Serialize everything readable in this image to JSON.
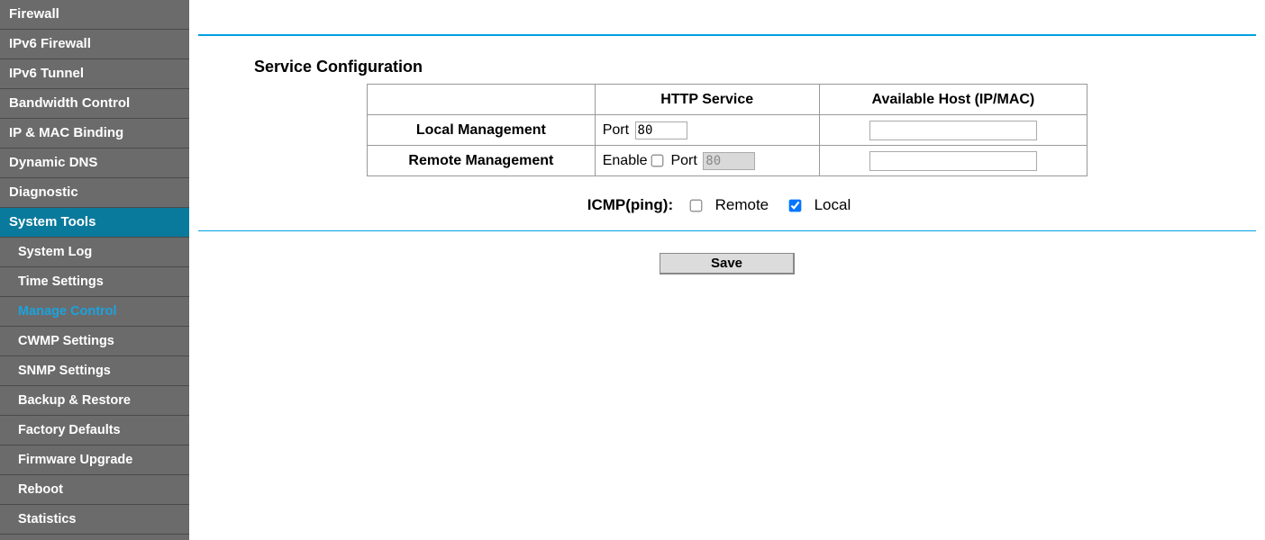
{
  "sidebar": {
    "items": [
      {
        "label": "Firewall",
        "kind": "nav",
        "sel": false
      },
      {
        "label": "IPv6 Firewall",
        "kind": "nav",
        "sel": false
      },
      {
        "label": "IPv6 Tunnel",
        "kind": "nav",
        "sel": false
      },
      {
        "label": "Bandwidth Control",
        "kind": "nav",
        "sel": false
      },
      {
        "label": "IP & MAC Binding",
        "kind": "nav",
        "sel": false
      },
      {
        "label": "Dynamic DNS",
        "kind": "nav",
        "sel": false
      },
      {
        "label": "Diagnostic",
        "kind": "nav",
        "sel": false
      },
      {
        "label": "System Tools",
        "kind": "nav",
        "sel": true
      },
      {
        "label": "System Log",
        "kind": "sub",
        "sel": false
      },
      {
        "label": "Time Settings",
        "kind": "sub",
        "sel": false
      },
      {
        "label": "Manage Control",
        "kind": "sub",
        "sel": true
      },
      {
        "label": "CWMP Settings",
        "kind": "sub",
        "sel": false
      },
      {
        "label": "SNMP Settings",
        "kind": "sub",
        "sel": false
      },
      {
        "label": "Backup & Restore",
        "kind": "sub",
        "sel": false
      },
      {
        "label": "Factory Defaults",
        "kind": "sub",
        "sel": false
      },
      {
        "label": "Firmware Upgrade",
        "kind": "sub",
        "sel": false
      },
      {
        "label": "Reboot",
        "kind": "sub",
        "sel": false
      },
      {
        "label": "Statistics",
        "kind": "sub",
        "sel": false
      }
    ]
  },
  "main": {
    "section_title": "Service Configuration",
    "table": {
      "headers": {
        "http": "HTTP Service",
        "host": "Available Host (IP/MAC)"
      },
      "rows": {
        "local": {
          "label": "Local Management",
          "port_label": "Port",
          "port_value": "80",
          "port_disabled": false,
          "host_value": ""
        },
        "remote": {
          "label": "Remote Management",
          "enable_label": "Enable",
          "enable_checked": false,
          "port_label": "Port",
          "port_value": "80",
          "port_disabled": true,
          "host_value": ""
        }
      }
    },
    "icmp": {
      "title": "ICMP(ping):",
      "remote_label": "Remote",
      "remote_checked": false,
      "local_label": "Local",
      "local_checked": true
    },
    "save_label": "Save"
  }
}
